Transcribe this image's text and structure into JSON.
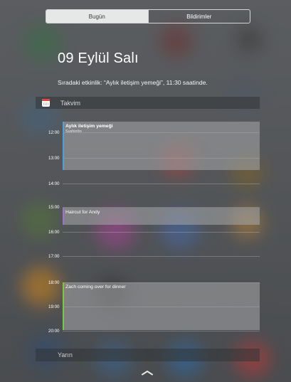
{
  "tabs": [
    {
      "label": "Bugün",
      "active": true
    },
    {
      "label": "Bildirimler",
      "active": false
    }
  ],
  "date_heading": "09 Eylül Salı",
  "next_event_summary": "Sıradaki etkinlik: “Aylık iletişim yemeği”, 11:30 saatinde.",
  "calendar": {
    "header_label": "Takvim",
    "icon": "calendar-icon",
    "hours": [
      "12:00",
      "13:00",
      "14:00",
      "15:00",
      "16:00",
      "17:00",
      "18:00",
      "19:00",
      "20:00"
    ],
    "events": [
      {
        "title": "Aylık iletişim yemeği",
        "location": "Sushirrito",
        "start": "11:30",
        "color": "#4aa3df"
      },
      {
        "title": "Haircut for Andy",
        "location": "",
        "start": "15:00",
        "color": "#a36fd1"
      },
      {
        "title": "Zach coming over for dinner",
        "location": "",
        "start": "18:00",
        "color": "#7ac943"
      }
    ]
  },
  "tomorrow_label": "Yarın",
  "grabber_icon": "chevron-up-icon"
}
